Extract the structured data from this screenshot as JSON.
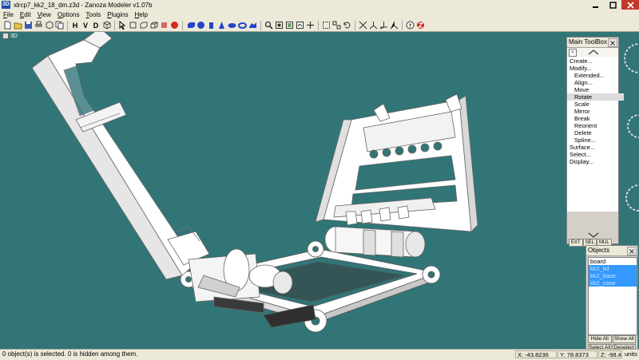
{
  "window": {
    "title": "xlrcp7_kk2_18_dm.z3d - Zanoza Modeler v1.07b",
    "icon_text": "3D"
  },
  "menu": [
    {
      "label": "File",
      "u": "F",
      "rest": "ile"
    },
    {
      "label": "Edit",
      "u": "E",
      "rest": "dit"
    },
    {
      "label": "View",
      "u": "V",
      "rest": "iew"
    },
    {
      "label": "Options",
      "u": "O",
      "rest": "ptions"
    },
    {
      "label": "Tools",
      "u": "T",
      "rest": "ools"
    },
    {
      "label": "Plugins",
      "u": "P",
      "rest": "lugins"
    },
    {
      "label": "Help",
      "u": "H",
      "rest": "elp"
    }
  ],
  "toolbar": {
    "h_label": "H",
    "v_label": "V",
    "d_label": "D"
  },
  "viewport": {
    "label": "3D",
    "background": "#317577"
  },
  "toolbox": {
    "title": "Main ToolBox",
    "items": [
      {
        "label": "Create..."
      },
      {
        "label": "Modify..."
      },
      {
        "label": "Extended..."
      },
      {
        "label": "Align..."
      },
      {
        "label": "Move"
      },
      {
        "label": "Rotate"
      },
      {
        "label": "Scale"
      },
      {
        "label": "Mirror"
      },
      {
        "label": "Break"
      },
      {
        "label": "Reorient"
      },
      {
        "label": "Delete"
      },
      {
        "label": "Spline..."
      },
      {
        "label": "Surface..."
      },
      {
        "label": "Select..."
      },
      {
        "label": "Display..."
      }
    ],
    "tabs": [
      "EXT",
      "SEL",
      "MUL"
    ]
  },
  "objects": {
    "title": "Objects",
    "items": [
      {
        "label": "board",
        "selected": false
      },
      {
        "label": "kk2_lid",
        "selected": true
      },
      {
        "label": "kk2_base",
        "selected": true
      },
      {
        "label": "kk2_case",
        "selected": true
      }
    ],
    "buttons": {
      "hide_all": "Hide All",
      "show_all": "Show All",
      "select_all": "Select All",
      "deselect": "Deselect"
    }
  },
  "status": {
    "message": "0 object(s) is selected. 0 is hidden among them.",
    "x": "X: -43.8236",
    "y": "Y: 78.8373",
    "z": "Z: -98.4317",
    "units": "units"
  },
  "colors": {
    "accent_selection": "#3399ff",
    "model": "#ffffff",
    "shadow": "#3c3c3c"
  }
}
